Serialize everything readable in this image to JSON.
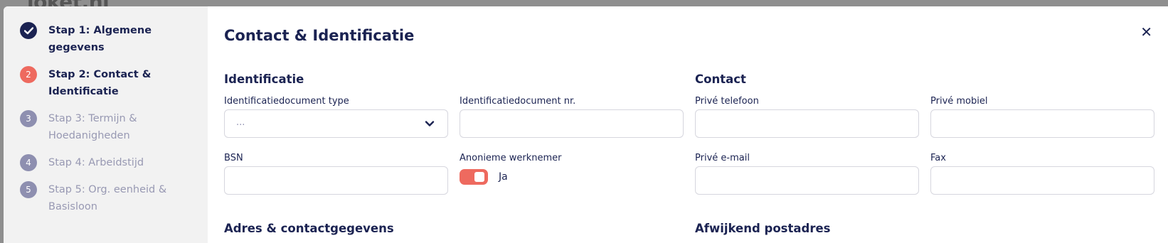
{
  "backdrop": {
    "logo_text": "loket.nl"
  },
  "steps": [
    {
      "number": "",
      "label": "Stap 1: Algemene gegevens",
      "state": "done"
    },
    {
      "number": "2",
      "label": "Stap 2: Contact & Identificatie",
      "state": "active"
    },
    {
      "number": "3",
      "label": "Stap 3: Termijn & Hoedanigheden",
      "state": "todo"
    },
    {
      "number": "4",
      "label": "Stap 4: Arbeidstijd",
      "state": "todo"
    },
    {
      "number": "5",
      "label": "Stap 5: Org. eenheid & Basisloon",
      "state": "todo"
    }
  ],
  "modal": {
    "title": "Contact & Identificatie",
    "close_symbol": "✕"
  },
  "identificatie": {
    "section_title": "Identificatie",
    "doc_type_label": "Identificatiedocument type",
    "doc_type_value": "...",
    "doc_nr_label": "Identificatiedocument nr.",
    "doc_nr_value": "",
    "bsn_label": "BSN",
    "bsn_value": "",
    "anoniem_label": "Anonieme werknemer",
    "anoniem_toggle_text": "Ja",
    "anoniem_on": true
  },
  "contact": {
    "section_title": "Contact",
    "tel_label": "Privé telefoon",
    "tel_value": "",
    "mobiel_label": "Privé mobiel",
    "mobiel_value": "",
    "email_label": "Privé e-mail",
    "email_value": "",
    "fax_label": "Fax",
    "fax_value": ""
  },
  "adres": {
    "section_title": "Adres & contactgegevens"
  },
  "postadres": {
    "section_title": "Afwijkend postadres"
  },
  "colors": {
    "navy": "#1b2352",
    "accent": "#ee6a5f",
    "muted": "#8e8fb0"
  }
}
